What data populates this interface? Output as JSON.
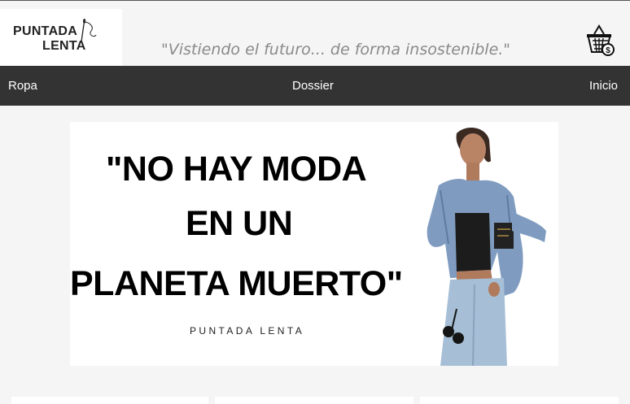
{
  "brand": {
    "logo_line1": "PUNTADA",
    "logo_line2": "LENTA",
    "tagline": "\"Vistiendo el futuro... de forma insostenible.\""
  },
  "icons": {
    "cart": "shopping-basket-dollar-icon",
    "logo_mark": "needle-thread-icon",
    "next": "chevron-right-icon"
  },
  "nav": {
    "left": "Ropa",
    "center": "Dossier",
    "right": "Inicio"
  },
  "banner": {
    "quote_line1": "\"NO HAY MODA",
    "quote_line2": "EN UN",
    "quote_line3": "PLANETA MUERTO\"",
    "brand_caption": "PUNTADA LENTA",
    "next_arrow": "›"
  },
  "colors": {
    "nav_bg": "#333333",
    "page_bg": "#f5f5f5",
    "tagline": "#8a8a8a"
  }
}
